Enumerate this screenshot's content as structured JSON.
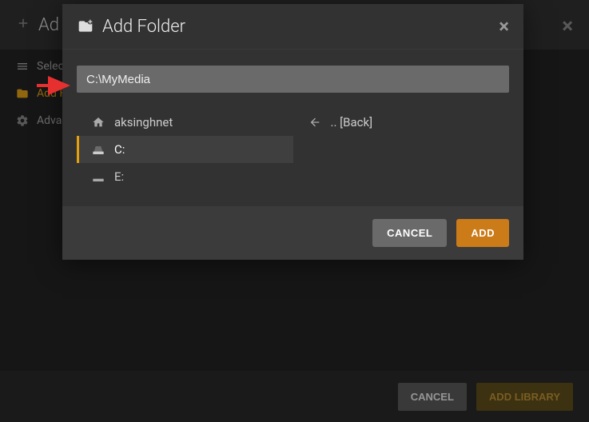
{
  "background": {
    "title": "Ad",
    "sidebar_select": "Selec",
    "sidebar_addfolder": "Add F",
    "sidebar_advanced": "Adva",
    "cancel": "CANCEL",
    "add_library": "ADD LIBRARY"
  },
  "modal": {
    "title": "Add Folder",
    "path_value": "C:\\MyMedia",
    "items": {
      "home": "aksinghnet",
      "back": ".. [Back]",
      "c_drive": "C:",
      "e_drive": "E:"
    },
    "cancel": "CANCEL",
    "add": "ADD"
  }
}
